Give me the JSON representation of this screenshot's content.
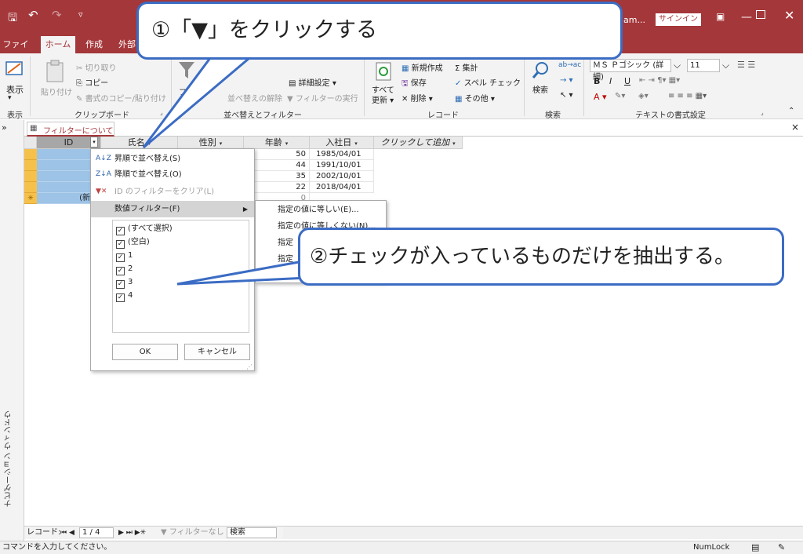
{
  "titlebar": {
    "account": "am...",
    "signin": "サインイン",
    "qat_save": "🖫",
    "qat_undo": "↶",
    "qat_redo": "↷",
    "qat_custom": "▿"
  },
  "tabs": [
    "ファイル",
    "ホーム",
    "作成",
    "外部"
  ],
  "ribbon": {
    "view": {
      "label": "表示",
      "group": "表示"
    },
    "clipboard": {
      "paste": "貼り付け",
      "cut": "切り取り",
      "copy": "コピー",
      "format_painter": "書式のコピー/貼り付け",
      "group": "クリップボード"
    },
    "sort_filter": {
      "filter": "フィ",
      "advanced": "詳細設定",
      "clear": "並べ替えの解除",
      "toggle": "フィルターの実行",
      "group": "並べ替えとフィルター"
    },
    "records": {
      "refresh": "すべて",
      "refresh2": "更新",
      "new": "新規作成",
      "save": "保存",
      "delete": "削除",
      "totals": "集計",
      "spelling": "スペル チェック",
      "more": "その他",
      "group": "レコード"
    },
    "find": {
      "find": "検索",
      "group": "検索"
    },
    "text_format": {
      "font": "ＭＳ Ｐゴシック (詳細)",
      "size": "11",
      "bold": "B",
      "italic": "I",
      "underline": "U",
      "group": "テキストの書式設定"
    }
  },
  "nav_pane": {
    "label": "ナビゲーション ウィンドウ",
    "toggle": "»"
  },
  "doc_tab": {
    "title": "フィルターについて",
    "close": "×"
  },
  "columns": [
    "ID",
    "氏名",
    "性別",
    "年齢",
    "入社日",
    "クリックして追加"
  ],
  "rows": [
    {
      "age": "50",
      "date": "1985/04/01"
    },
    {
      "age": "44",
      "date": "1991/10/01"
    },
    {
      "age": "35",
      "date": "2002/10/01"
    },
    {
      "age": "22",
      "date": "2018/04/01"
    }
  ],
  "new_row": {
    "marker": "✳",
    "id": "(新規",
    "age": "0"
  },
  "filter_menu": {
    "sort_asc": "昇順で並べ替え(S)",
    "sort_desc": "降順で並べ替え(O)",
    "clear_filter": "ID のフィルターをクリア(L)",
    "number_filter": "数値フィルター(F)",
    "checks": [
      "(すべて選択)",
      "(空白)",
      "1",
      "2",
      "3",
      "4"
    ],
    "ok": "OK",
    "cancel": "キャンセル"
  },
  "submenu": {
    "items": [
      "指定の値に等しい(E)...",
      "指定の値に等しくない(N)...",
      "指定",
      "指定",
      "指定"
    ]
  },
  "callouts": {
    "first": "①「▼」をクリックする",
    "second": "②チェックが入っているものだけを抽出する。"
  },
  "record_nav": {
    "label": "レコード:",
    "position": "1 / 4",
    "filter_state": "フィルターなし",
    "search": "検索"
  },
  "status": {
    "message": "コマンドを入力してください。",
    "numlock": "NumLock"
  },
  "colors": {
    "accent": "#a4373a",
    "callout_border": "#3b6cc4",
    "selected_cell": "#9dc3e6",
    "row_selector": "#f6c14a"
  }
}
